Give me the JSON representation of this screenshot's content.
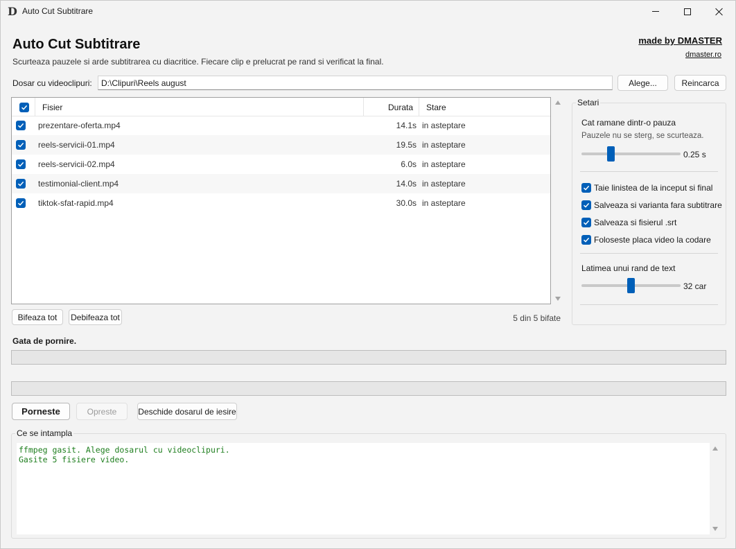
{
  "window": {
    "title": "Auto Cut Subtitrare",
    "icon_letter": "D"
  },
  "header": {
    "title": "Auto Cut Subtitrare",
    "subtitle": "Scurteaza pauzele si arde subtitrarea cu diacritice. Fiecare clip e prelucrat pe rand si verificat la final.",
    "brand": "made by DMASTER",
    "brand_site": "dmaster.ro"
  },
  "folder": {
    "label": "Dosar cu videoclipuri:",
    "value": "D:\\Clipuri\\Reels august",
    "choose_label": "Alege...",
    "reload_label": "Reincarca"
  },
  "filelist": {
    "columns": {
      "name": "Fisier",
      "duration": "Durata",
      "state": "Stare"
    },
    "header_checked": true,
    "rows": [
      {
        "checked": true,
        "name": "prezentare-oferta.mp4",
        "duration": "14.1s",
        "state": "in asteptare"
      },
      {
        "checked": true,
        "name": "reels-servicii-01.mp4",
        "duration": "19.5s",
        "state": "in asteptare"
      },
      {
        "checked": true,
        "name": "reels-servicii-02.mp4",
        "duration": "6.0s",
        "state": "in asteptare"
      },
      {
        "checked": true,
        "name": "testimonial-client.mp4",
        "duration": "14.0s",
        "state": "in asteptare"
      },
      {
        "checked": true,
        "name": "tiktok-sfat-rapid.mp4",
        "duration": "30.0s",
        "state": "in asteptare"
      }
    ],
    "check_all_label": "Bifeaza tot",
    "uncheck_all_label": "Debifeaza tot",
    "count_text": "5 din 5 bifate"
  },
  "settings": {
    "legend": "Setari",
    "pause": {
      "label": "Cat ramane dintr-o pauza",
      "hint": "Pauzele nu se sterg, se scurteaza.",
      "value_text": "0.25 s",
      "level": 0.28
    },
    "options": [
      {
        "label": "Taie linistea de la inceput si final",
        "checked": true
      },
      {
        "label": "Salveaza si varianta fara subtitrare",
        "checked": true
      },
      {
        "label": "Salveaza si fisierul .srt",
        "checked": true
      },
      {
        "label": "Foloseste placa video la codare",
        "checked": true
      }
    ],
    "line_width": {
      "label": "Latimea unui rand de text",
      "value_text": "32 car",
      "level": 0.5
    }
  },
  "status": {
    "text": "Gata de pornire.",
    "progress_file": 0,
    "progress_total": 0
  },
  "actions": {
    "start_label": "Porneste",
    "stop_label": "Opreste",
    "open_output_label": "Deschide dosarul de iesire"
  },
  "log": {
    "legend": "Ce se intampla",
    "lines": [
      "ffmpeg gasit. Alege dosarul cu videoclipuri.",
      "Gasite 5 fisiere video."
    ]
  },
  "colors": {
    "accent": "#005fb8",
    "log_text": "#1e7e1e"
  }
}
